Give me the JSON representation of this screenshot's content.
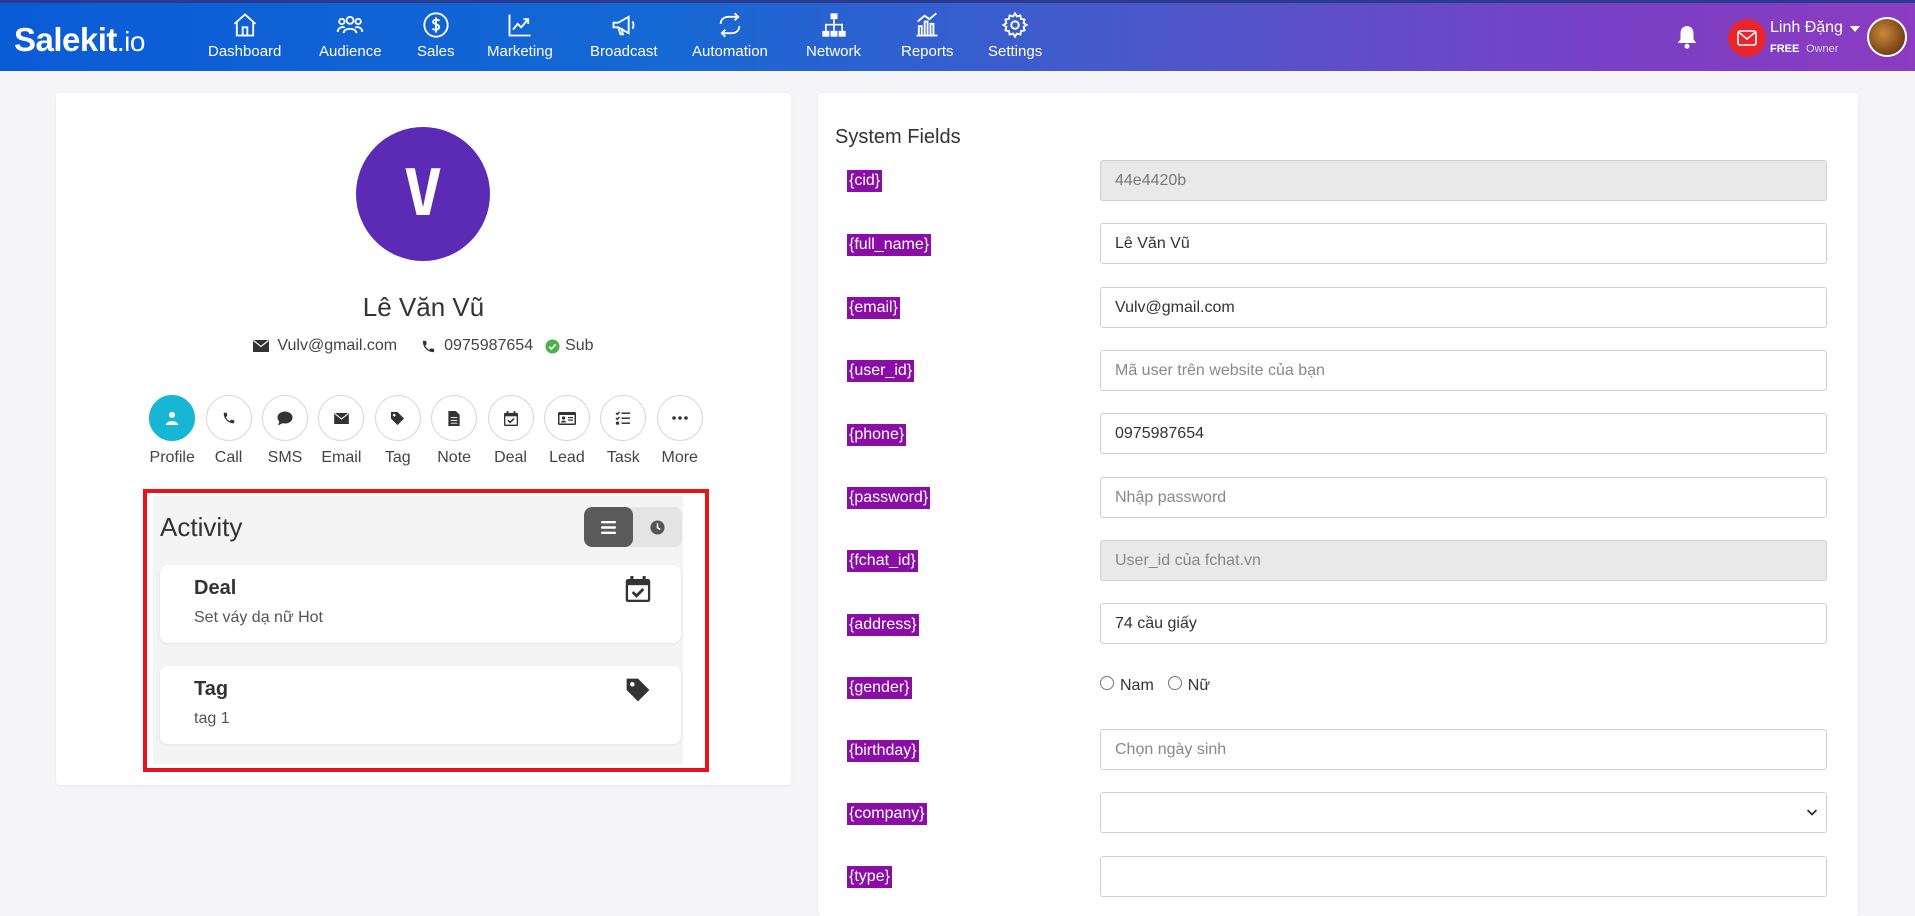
{
  "brand": {
    "name": "Salekit",
    "suffix": ".io"
  },
  "nav": [
    {
      "label": "Dashboard",
      "icon": "home-icon"
    },
    {
      "label": "Audience",
      "icon": "users-icon"
    },
    {
      "label": "Sales",
      "icon": "dollar-icon"
    },
    {
      "label": "Marketing",
      "icon": "chart-line-icon"
    },
    {
      "label": "Broadcast",
      "icon": "megaphone-icon"
    },
    {
      "label": "Automation",
      "icon": "repeat-icon"
    },
    {
      "label": "Network",
      "icon": "network-icon"
    },
    {
      "label": "Reports",
      "icon": "bar-chart-icon"
    },
    {
      "label": "Settings",
      "icon": "gear-icon"
    }
  ],
  "user": {
    "name": "Linh Đặng",
    "plan": "FREE",
    "role": "Owner"
  },
  "profile": {
    "initial": "V",
    "name": "Lê Văn Vũ",
    "email": "Vulv@gmail.com",
    "phone": "0975987654",
    "status": "Sub"
  },
  "actions": [
    {
      "label": "Profile",
      "icon": "user-icon"
    },
    {
      "label": "Call",
      "icon": "phone-icon"
    },
    {
      "label": "SMS",
      "icon": "chat-icon"
    },
    {
      "label": "Email",
      "icon": "envelope-icon"
    },
    {
      "label": "Tag",
      "icon": "tag-icon"
    },
    {
      "label": "Note",
      "icon": "note-icon"
    },
    {
      "label": "Deal",
      "icon": "calendar-check-icon"
    },
    {
      "label": "Lead",
      "icon": "id-card-icon"
    },
    {
      "label": "Task",
      "icon": "task-list-icon"
    },
    {
      "label": "More",
      "icon": "ellipsis-icon"
    }
  ],
  "activity": {
    "title": "Activity",
    "items": [
      {
        "title": "Deal",
        "subtitle": "Set váy dạ nữ Hot",
        "icon": "calendar-check-icon"
      },
      {
        "title": "Tag",
        "subtitle": "tag 1",
        "icon": "tag-icon"
      }
    ]
  },
  "system_fields": {
    "title": "System Fields",
    "fields": {
      "cid": {
        "label": "{cid}",
        "value": "44e4420b",
        "placeholder": ""
      },
      "full_name": {
        "label": "{full_name}",
        "value": "Lê Văn Vũ",
        "placeholder": ""
      },
      "email": {
        "label": "{email}",
        "value": "Vulv@gmail.com",
        "placeholder": ""
      },
      "user_id": {
        "label": "{user_id}",
        "value": "",
        "placeholder": "Mã user trên website của bạn"
      },
      "phone": {
        "label": "{phone}",
        "value": "0975987654",
        "placeholder": ""
      },
      "password": {
        "label": "{password}",
        "value": "",
        "placeholder": "Nhập password"
      },
      "fchat_id": {
        "label": "{fchat_id}",
        "value": "",
        "placeholder": "User_id của fchat.vn"
      },
      "address": {
        "label": "{address}",
        "value": "74 cầu giấy",
        "placeholder": ""
      },
      "gender": {
        "label": "{gender}",
        "options": [
          "Nam",
          "Nữ"
        ]
      },
      "birthday": {
        "label": "{birthday}",
        "value": "",
        "placeholder": "Chọn ngày sinh"
      },
      "company": {
        "label": "{company}",
        "value": ""
      },
      "type": {
        "label": "{type}",
        "value": ""
      }
    }
  }
}
